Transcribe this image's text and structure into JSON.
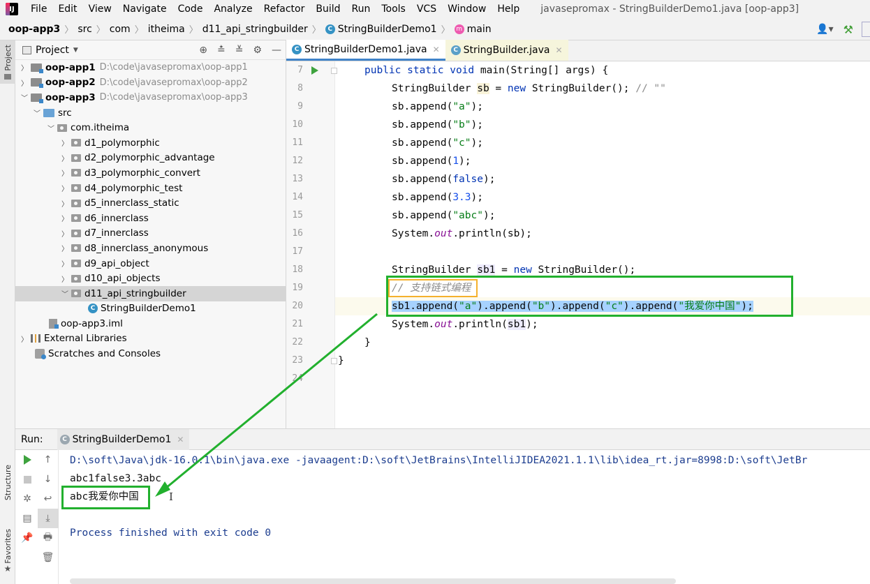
{
  "menubar": {
    "logo": "IJ",
    "items": [
      {
        "label": "File"
      },
      {
        "label": "Edit"
      },
      {
        "label": "View"
      },
      {
        "label": "Navigate"
      },
      {
        "label": "Code"
      },
      {
        "label": "Analyze"
      },
      {
        "label": "Refactor"
      },
      {
        "label": "Build"
      },
      {
        "label": "Run"
      },
      {
        "label": "Tools"
      },
      {
        "label": "VCS"
      },
      {
        "label": "Window"
      },
      {
        "label": "Help"
      }
    ],
    "window_title": "javasepromax - StringBuilderDemo1.java [oop-app3]"
  },
  "breadcrumb": {
    "items": [
      "oop-app3",
      "src",
      "com",
      "itheima",
      "d11_api_stringbuilder",
      "StringBuilderDemo1",
      "main"
    ]
  },
  "sidebar_left": {
    "project_tab": "Project",
    "structure_tab": "Structure",
    "favorites_tab": "Favorites"
  },
  "project": {
    "title": "Project",
    "tree": [
      {
        "label": "oop-app1",
        "path": "D:\\code\\javasepromax\\oop-app1",
        "icon": "module-folder-icon"
      },
      {
        "label": "oop-app2",
        "path": "D:\\code\\javasepromax\\oop-app2",
        "icon": "module-folder-icon"
      },
      {
        "label": "oop-app3",
        "path": "D:\\code\\javasepromax\\oop-app3",
        "icon": "module-folder-icon"
      },
      {
        "label": "src",
        "icon": "source-folder-icon"
      },
      {
        "label": "com.itheima",
        "icon": "package-icon"
      },
      {
        "label": "d1_polymorphic",
        "icon": "package-icon"
      },
      {
        "label": "d2_polymorphic_advantage",
        "icon": "package-icon"
      },
      {
        "label": "d3_polymorphic_convert",
        "icon": "package-icon"
      },
      {
        "label": "d4_polymorphic_test",
        "icon": "package-icon"
      },
      {
        "label": "d5_innerclass_static",
        "icon": "package-icon"
      },
      {
        "label": "d6_innerclass",
        "icon": "package-icon"
      },
      {
        "label": "d7_innerclass",
        "icon": "package-icon"
      },
      {
        "label": "d8_innerclass_anonymous",
        "icon": "package-icon"
      },
      {
        "label": "d9_api_object",
        "icon": "package-icon"
      },
      {
        "label": "d10_api_objects",
        "icon": "package-icon"
      },
      {
        "label": "d11_api_stringbuilder",
        "icon": "package-icon"
      },
      {
        "label": "StringBuilderDemo1",
        "icon": "class-icon"
      },
      {
        "label": "oop-app3.iml",
        "icon": "iml-file-icon"
      },
      {
        "label": "External Libraries",
        "icon": "library-icon"
      },
      {
        "label": "Scratches and Consoles",
        "icon": "scratch-icon"
      }
    ]
  },
  "editor": {
    "tabs": [
      {
        "label": "StringBuilderDemo1.java",
        "active": true
      },
      {
        "label": "StringBuilder.java",
        "active": false
      }
    ],
    "line_numbers": [
      "7",
      "8",
      "9",
      "10",
      "11",
      "12",
      "13",
      "14",
      "15",
      "16",
      "17",
      "18",
      "19",
      "20",
      "21",
      "22",
      "23",
      "24"
    ],
    "code": {
      "l7_a": "public static void ",
      "l7_b": "main",
      "l7_c": "(String[] args) {",
      "l8_a": "StringBuilder ",
      "l8_b": "sb",
      "l8_c": " = ",
      "l8_d": "new",
      "l8_e": " StringBuilder(); ",
      "l8_f": "// \"\"",
      "l9_a": "sb.append(",
      "l9_b": "\"a\"",
      "l9_c": ");",
      "l10_a": "sb.append(",
      "l10_b": "\"b\"",
      "l10_c": ");",
      "l11_a": "sb.append(",
      "l11_b": "\"c\"",
      "l11_c": ");",
      "l12_a": "sb.append(",
      "l12_b": "1",
      "l12_c": ");",
      "l13_a": "sb.append(",
      "l13_b": "false",
      "l13_c": ");",
      "l14_a": "sb.append(",
      "l14_b": "3.3",
      "l14_c": ");",
      "l15_a": "sb.append(",
      "l15_b": "\"abc\"",
      "l15_c": ");",
      "l16_a": "System.",
      "l16_b": "out",
      "l16_c": ".println(sb);",
      "l18_a": "StringBuilder ",
      "l18_b": "sb1",
      "l18_c": " = ",
      "l18_d": "new",
      "l18_e": " StringBuilder();",
      "l19": "// 支持链式编程",
      "l20_a": "sb1.append(",
      "l20_b": "\"a\"",
      "l20_c": ").append(",
      "l20_d": "\"b\"",
      "l20_e": ").append(",
      "l20_f": "\"c\"",
      "l20_g": ").append(",
      "l20_h": "\"我爱你中国\"",
      "l20_i": ");",
      "l21_a": "System.",
      "l21_b": "out",
      "l21_c": ".println(",
      "l21_d": "sb1",
      "l21_e": ");",
      "l22": "}",
      "l23": "}"
    }
  },
  "run": {
    "label": "Run:",
    "tab": "StringBuilderDemo1",
    "console": {
      "cmd": "D:\\soft\\Java\\jdk-16.0.1\\bin\\java.exe -javaagent:D:\\soft\\JetBrains\\IntelliJIDEA2021.1.1\\lib\\idea_rt.jar=8998:D:\\soft\\JetBr",
      "out1": "abc1false3.3abc",
      "out2": "abc我爱你中国",
      "exit": "Process finished with exit code 0"
    }
  },
  "colors": {
    "annotation_green": "#22b02e",
    "annotation_orange": "#f5b12c",
    "selection": "#a6d2ff"
  }
}
